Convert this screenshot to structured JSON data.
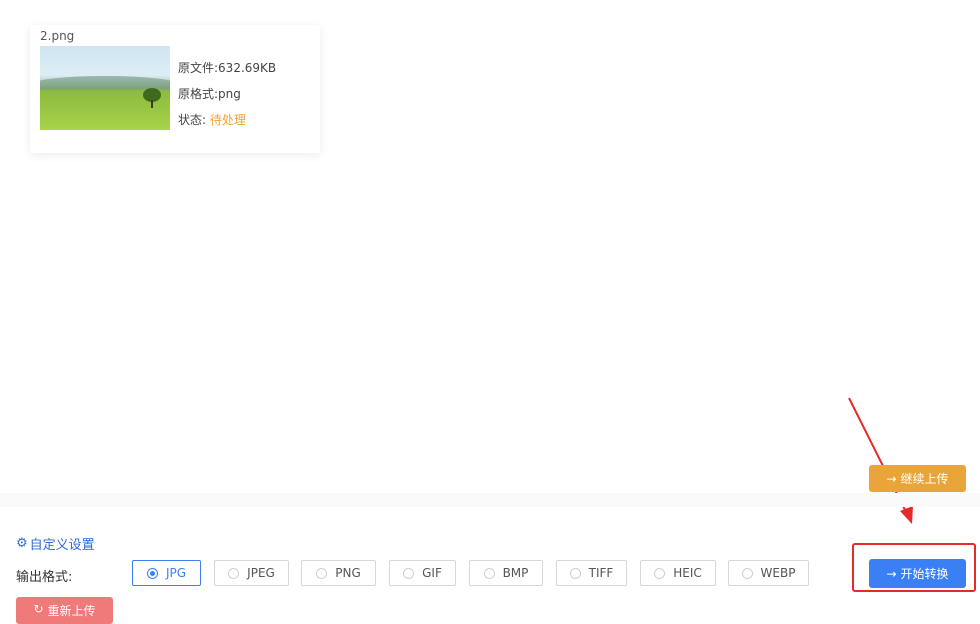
{
  "file": {
    "name": "2.png",
    "size_text": "原文件:632.69KB",
    "format_text": "原格式:png",
    "status_label": "状态:",
    "status_value": "待处理"
  },
  "actions": {
    "continue_upload": "继续上传",
    "reupload": "重新上传",
    "start_convert": "开始转换"
  },
  "settings": {
    "custom_settings": "自定义设置",
    "output_format_label": "输出格式:",
    "formats": [
      "JPG",
      "JPEG",
      "PNG",
      "GIF",
      "BMP",
      "TIFF",
      "HEIC",
      "WEBP"
    ],
    "selected_format": "JPG"
  },
  "colors": {
    "accent_blue": "#3b7ff5",
    "continue_orange": "#e9a53a",
    "reupload_red": "#f07a7a",
    "status_orange": "#f2a23a",
    "annotation_red": "#e52a2a"
  }
}
